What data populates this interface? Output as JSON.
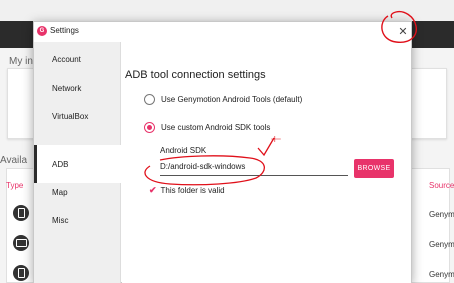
{
  "background": {
    "my_instances_label": "My in",
    "available_label": "Availa",
    "table": {
      "type_header": "Type",
      "source_header": "Source",
      "rows": [
        {
          "source": "Genymo",
          "device": "phone-icon"
        },
        {
          "source": "Genymo",
          "device": "tablet-icon"
        },
        {
          "source": "Genymo",
          "device": "phone-icon"
        }
      ]
    }
  },
  "dialog": {
    "title": "Settings",
    "close_glyph": "✕",
    "sidebar": {
      "items": [
        {
          "label": "Account",
          "active": false
        },
        {
          "label": "Network",
          "active": false
        },
        {
          "label": "VirtualBox",
          "active": false
        },
        {
          "label": "ADB",
          "active": true
        },
        {
          "label": "Map",
          "active": false
        },
        {
          "label": "Misc",
          "active": false
        }
      ]
    },
    "adb": {
      "section_title": "ADB tool connection settings",
      "option_genymotion": "Use Genymotion Android Tools (default)",
      "option_custom": "Use custom Android SDK tools",
      "selected_option": "custom",
      "sdk_label": "Android SDK",
      "sdk_path": "D:/android-sdk-windows",
      "browse_label": "BROWSE",
      "valid_message": "This folder is valid"
    }
  },
  "colors": {
    "accent": "#e8336a",
    "annotation": "#e0101a"
  }
}
